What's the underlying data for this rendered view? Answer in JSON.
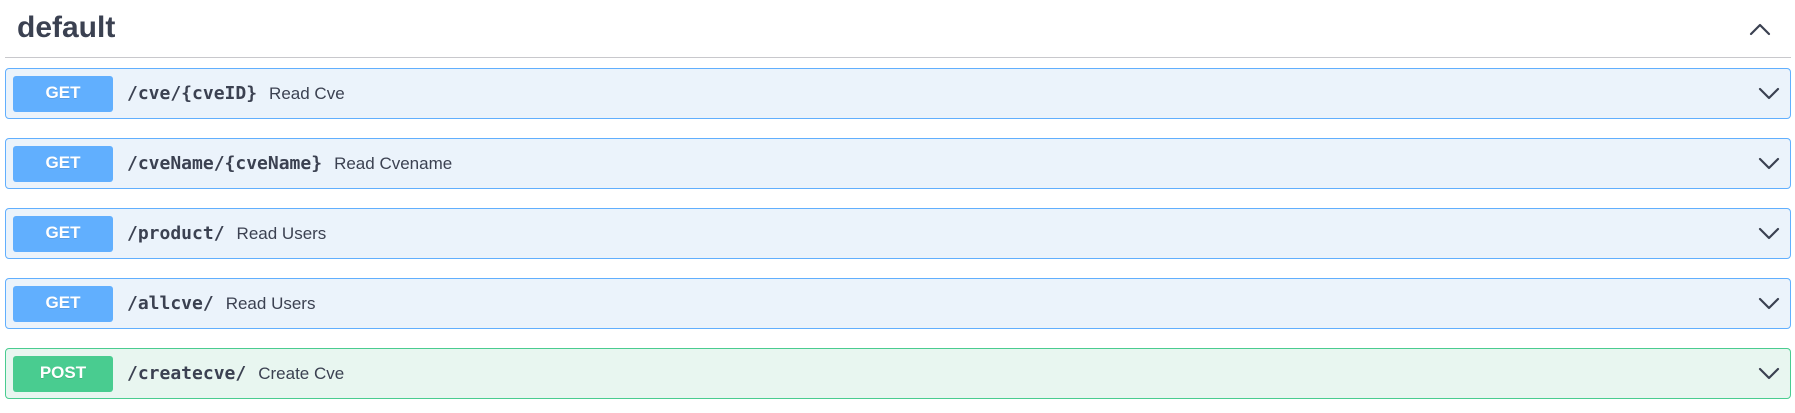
{
  "section": {
    "title": "default"
  },
  "operations": [
    {
      "method": "GET",
      "path": "/cve/{cveID}",
      "summary": "Read Cve"
    },
    {
      "method": "GET",
      "path": "/cveName/{cveName}",
      "summary": "Read Cvename"
    },
    {
      "method": "GET",
      "path": "/product/",
      "summary": "Read Users"
    },
    {
      "method": "GET",
      "path": "/allcve/",
      "summary": "Read Users"
    },
    {
      "method": "POST",
      "path": "/createcve/",
      "summary": "Create Cve"
    }
  ],
  "colors": {
    "get_accent": "#61affe",
    "get_background": "#ebf3fb",
    "post_accent": "#49cc90",
    "post_background": "#e8f6f0",
    "text": "#3b4151"
  },
  "icons": {
    "section_toggle": "chevron-up-icon",
    "operation_toggle": "chevron-down-icon"
  }
}
